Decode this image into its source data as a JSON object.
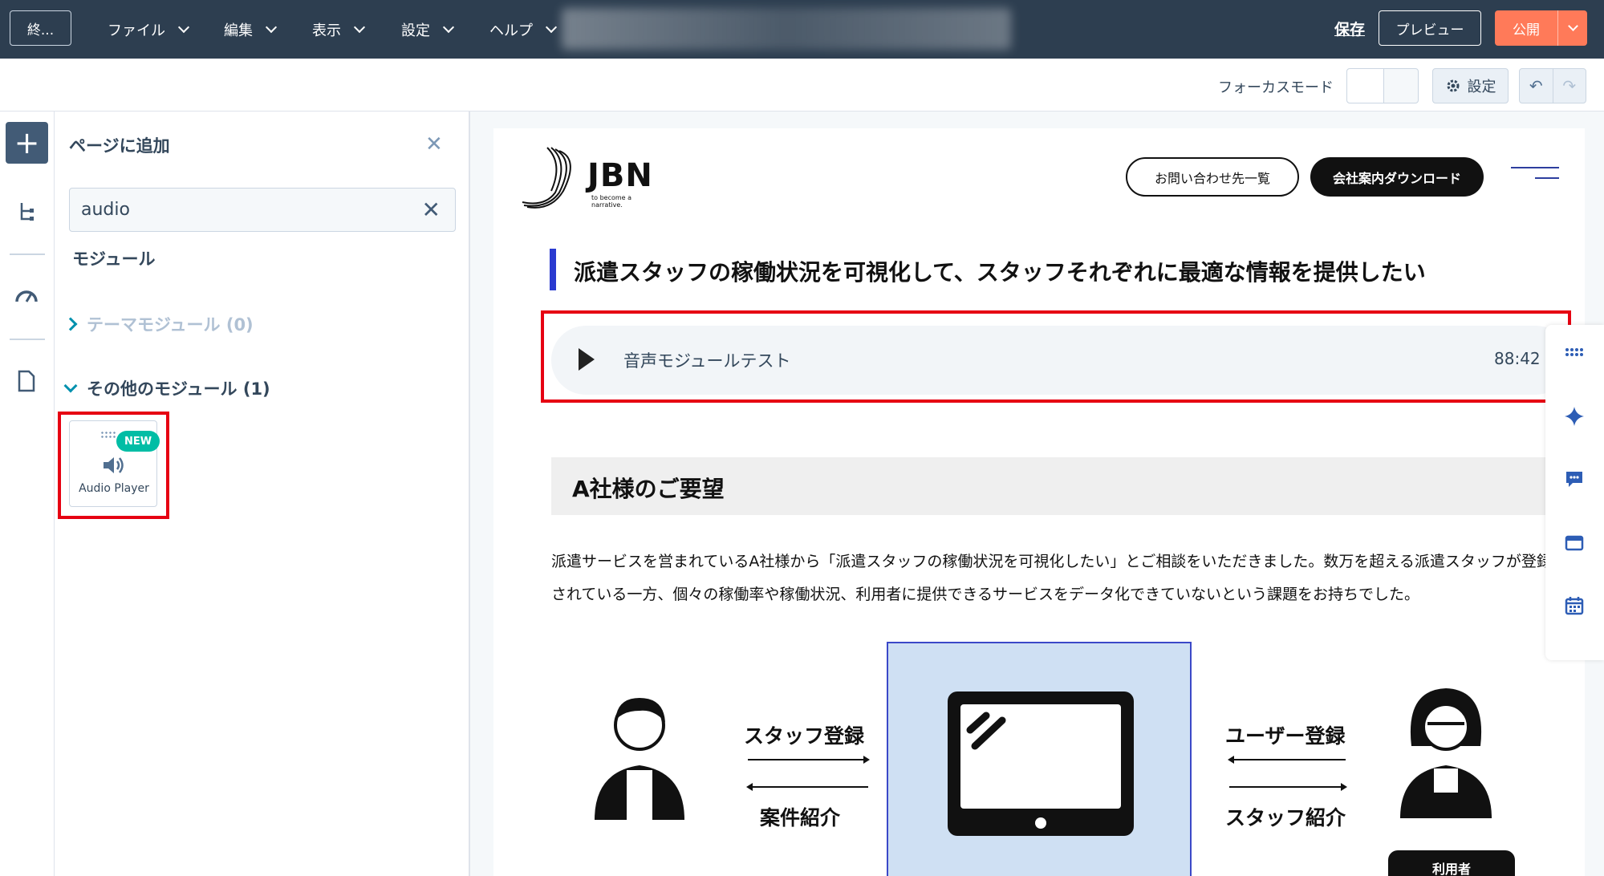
{
  "topbar": {
    "exit_label": "終...",
    "menus": [
      {
        "label": "ファイル"
      },
      {
        "label": "編集"
      },
      {
        "label": "表示"
      },
      {
        "label": "設定"
      },
      {
        "label": "ヘルプ"
      }
    ],
    "save_label": "保存",
    "preview_label": "プレビュー",
    "publish_label": "公開"
  },
  "subbar": {
    "focus_mode_label": "フォーカスモード",
    "settings_label": "設定",
    "undo_icon": "undo-icon",
    "redo_icon": "redo-icon"
  },
  "panel": {
    "title": "ページに追加",
    "search_value": "audio",
    "section_heading": "モジュール",
    "theme_group": "テーマモジュール (0)",
    "other_group": "その他のモジュール (1)",
    "module_card": {
      "badge": "NEW",
      "label": "Audio Player"
    }
  },
  "page": {
    "logo_text": "JBN",
    "logo_tagline": "to become a narrative.",
    "contact_button": "お問い合わせ先一覧",
    "download_button": "会社案内ダウンロード",
    "heading": "派遣スタッフの稼働状況を可視化して、スタッフそれぞれに最適な情報を提供したい",
    "audio_player": {
      "title": "音声モジュールテスト",
      "duration": "88:42"
    },
    "section_heading": "A社様のご要望",
    "paragraph": "派遣サービスを営まれているA社様から「派遣スタッフの稼働状況を可視化したい」とご相談をいただきました。数万を超える派遣スタッフが登録されている一方、個々の稼働率や稼働状況、利用者に提供できるサービスをデータ化できていないという課題をお持ちでした。",
    "diagram": {
      "staff_register": "スタッフ登録",
      "job_intro": "案件紹介",
      "user_register": "ユーザー登録",
      "staff_intro": "スタッフ紹介",
      "user_tag": "利用者"
    }
  },
  "colors": {
    "topbar": "#2d3e50",
    "publish": "#ff7a59",
    "highlight": "#e60012",
    "accent": "#2a3ad0",
    "badge": "#00bda5"
  }
}
